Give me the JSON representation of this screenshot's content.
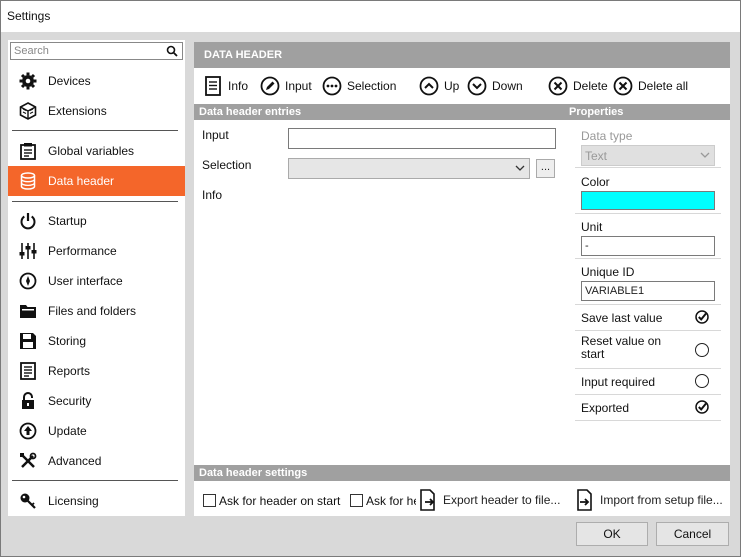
{
  "window": {
    "title": "Settings"
  },
  "sidebar": {
    "search_placeholder": "Search",
    "items": [
      {
        "label": "Devices",
        "icon": "gear-icon"
      },
      {
        "label": "Extensions",
        "icon": "cube-icon"
      },
      {
        "label": "Global variables",
        "icon": "clipboard-icon"
      },
      {
        "label": "Data header",
        "icon": "database-icon",
        "active": true
      },
      {
        "label": "Startup",
        "icon": "power-icon"
      },
      {
        "label": "Performance",
        "icon": "sliders-icon"
      },
      {
        "label": "User interface",
        "icon": "compass-icon"
      },
      {
        "label": "Files and folders",
        "icon": "folder-icon"
      },
      {
        "label": "Storing",
        "icon": "floppy-icon"
      },
      {
        "label": "Reports",
        "icon": "report-icon"
      },
      {
        "label": "Security",
        "icon": "lock-icon"
      },
      {
        "label": "Update",
        "icon": "update-icon"
      },
      {
        "label": "Advanced",
        "icon": "tools-icon"
      },
      {
        "label": "Licensing",
        "icon": "key-icon"
      }
    ]
  },
  "main": {
    "header": "DATA HEADER",
    "toolbar": {
      "info": "Info",
      "input": "Input",
      "selection": "Selection",
      "up": "Up",
      "down": "Down",
      "delete": "Delete",
      "delete_all": "Delete all"
    },
    "entries_title": "Data header entries",
    "properties_title": "Properties",
    "fields": {
      "input_label": "Input",
      "input_value": "",
      "selection_label": "Selection",
      "selection_value": "",
      "more_button": "...",
      "info_label": "Info"
    },
    "properties": {
      "data_type_label": "Data type",
      "data_type_value": "Text",
      "color_label": "Color",
      "color_value": "#00ffff",
      "unit_label": "Unit",
      "unit_value": "-",
      "unique_id_label": "Unique ID",
      "unique_id_value": "VARIABLE1",
      "save_last_value_label": "Save last value",
      "save_last_value": true,
      "reset_value_label": "Reset value on start",
      "reset_value": false,
      "input_required_label": "Input required",
      "input_required": false,
      "exported_label": "Exported",
      "exported": true
    },
    "settings_title": "Data header settings",
    "settings": {
      "ask_header_on_start": "Ask for header on start",
      "ask_for_he": "Ask for he",
      "export_header": "Export header to file...",
      "import_setup": "Import from setup file..."
    }
  },
  "dialog": {
    "ok": "OK",
    "cancel": "Cancel"
  },
  "colors": {
    "accent": "#f4662a",
    "section": "#a0a0a0",
    "background": "#d9d9d9"
  }
}
